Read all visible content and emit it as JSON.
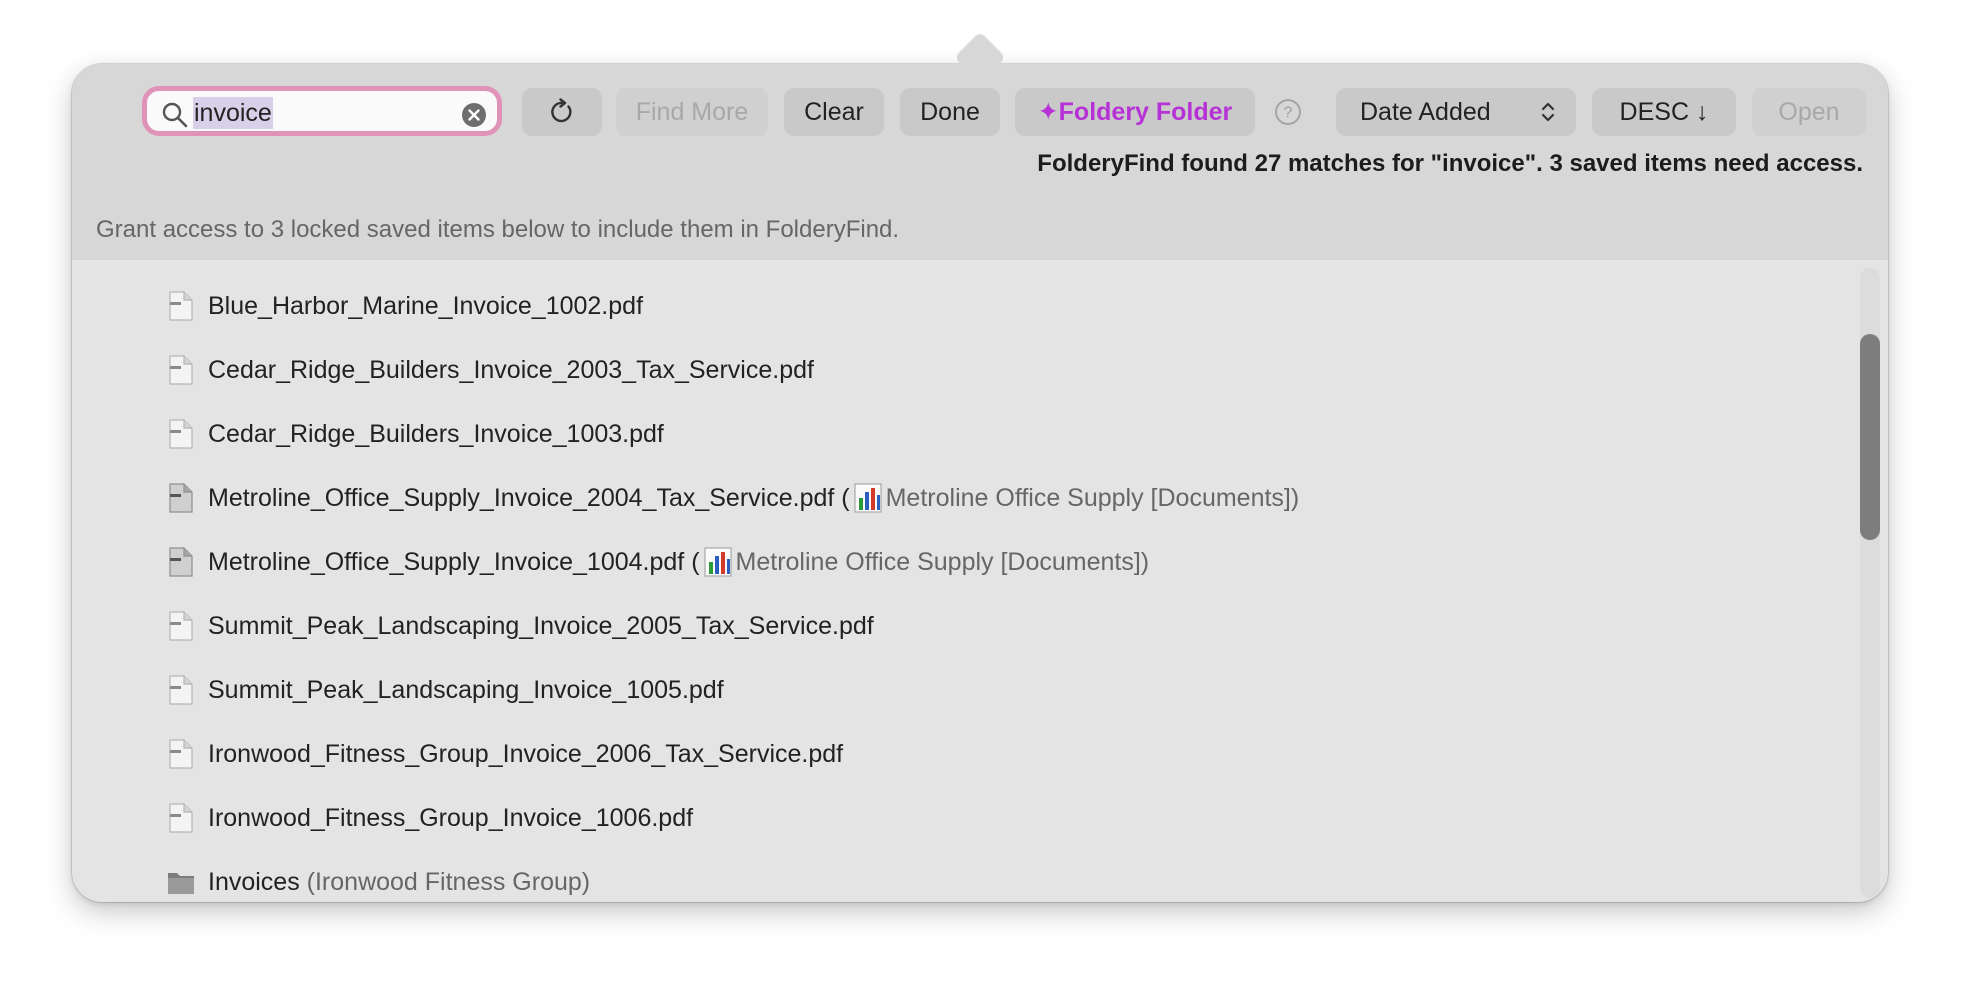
{
  "toolbar": {
    "search_value": "invoice",
    "refresh_icon": "refresh-icon",
    "find_more_label": "Find More",
    "clear_label": "Clear",
    "done_label": "Done",
    "foldery_label": "✦Foldery Folder",
    "sort_field": "Date Added",
    "sort_order": "DESC ↓",
    "open_label": "Open"
  },
  "status_text": "FolderyFind found 27 matches for \"invoice\". 3 saved items need access.",
  "grant_text": "Grant access to 3 locked saved items below to include them in FolderyFind.",
  "colors": {
    "accent": "#b632d6",
    "search_focus": "#e093b8",
    "panel": "#e4e4e4",
    "header": "#d7d7d7"
  },
  "results": [
    {
      "name": "Blue_Harbor_Marine_Invoice_1002.pdf",
      "icon": "pdf-file-icon"
    },
    {
      "name": "Cedar_Ridge_Builders_Invoice_2003_Tax_Service.pdf",
      "icon": "pdf-file-icon"
    },
    {
      "name": "Cedar_Ridge_Builders_Invoice_1003.pdf",
      "icon": "pdf-file-icon"
    },
    {
      "name": "Metroline_Office_Supply_Invoice_2004_Tax_Service.pdf",
      "icon": "pdf-file-icon",
      "open": " (",
      "location": "Metroline Office Supply [Documents])"
    },
    {
      "name": "Metroline_Office_Supply_Invoice_1004.pdf",
      "icon": "pdf-file-icon",
      "open": " (",
      "location": "Metroline Office Supply [Documents])"
    },
    {
      "name": "Summit_Peak_Landscaping_Invoice_2005_Tax_Service.pdf",
      "icon": "pdf-file-icon"
    },
    {
      "name": "Summit_Peak_Landscaping_Invoice_1005.pdf",
      "icon": "pdf-file-icon"
    },
    {
      "name": "Ironwood_Fitness_Group_Invoice_2006_Tax_Service.pdf",
      "icon": "pdf-file-icon"
    },
    {
      "name": "Ironwood_Fitness_Group_Invoice_1006.pdf",
      "icon": "pdf-file-icon"
    },
    {
      "name": "Invoices",
      "icon": "folder-icon",
      "location": " (Ironwood Fitness Group)"
    }
  ]
}
